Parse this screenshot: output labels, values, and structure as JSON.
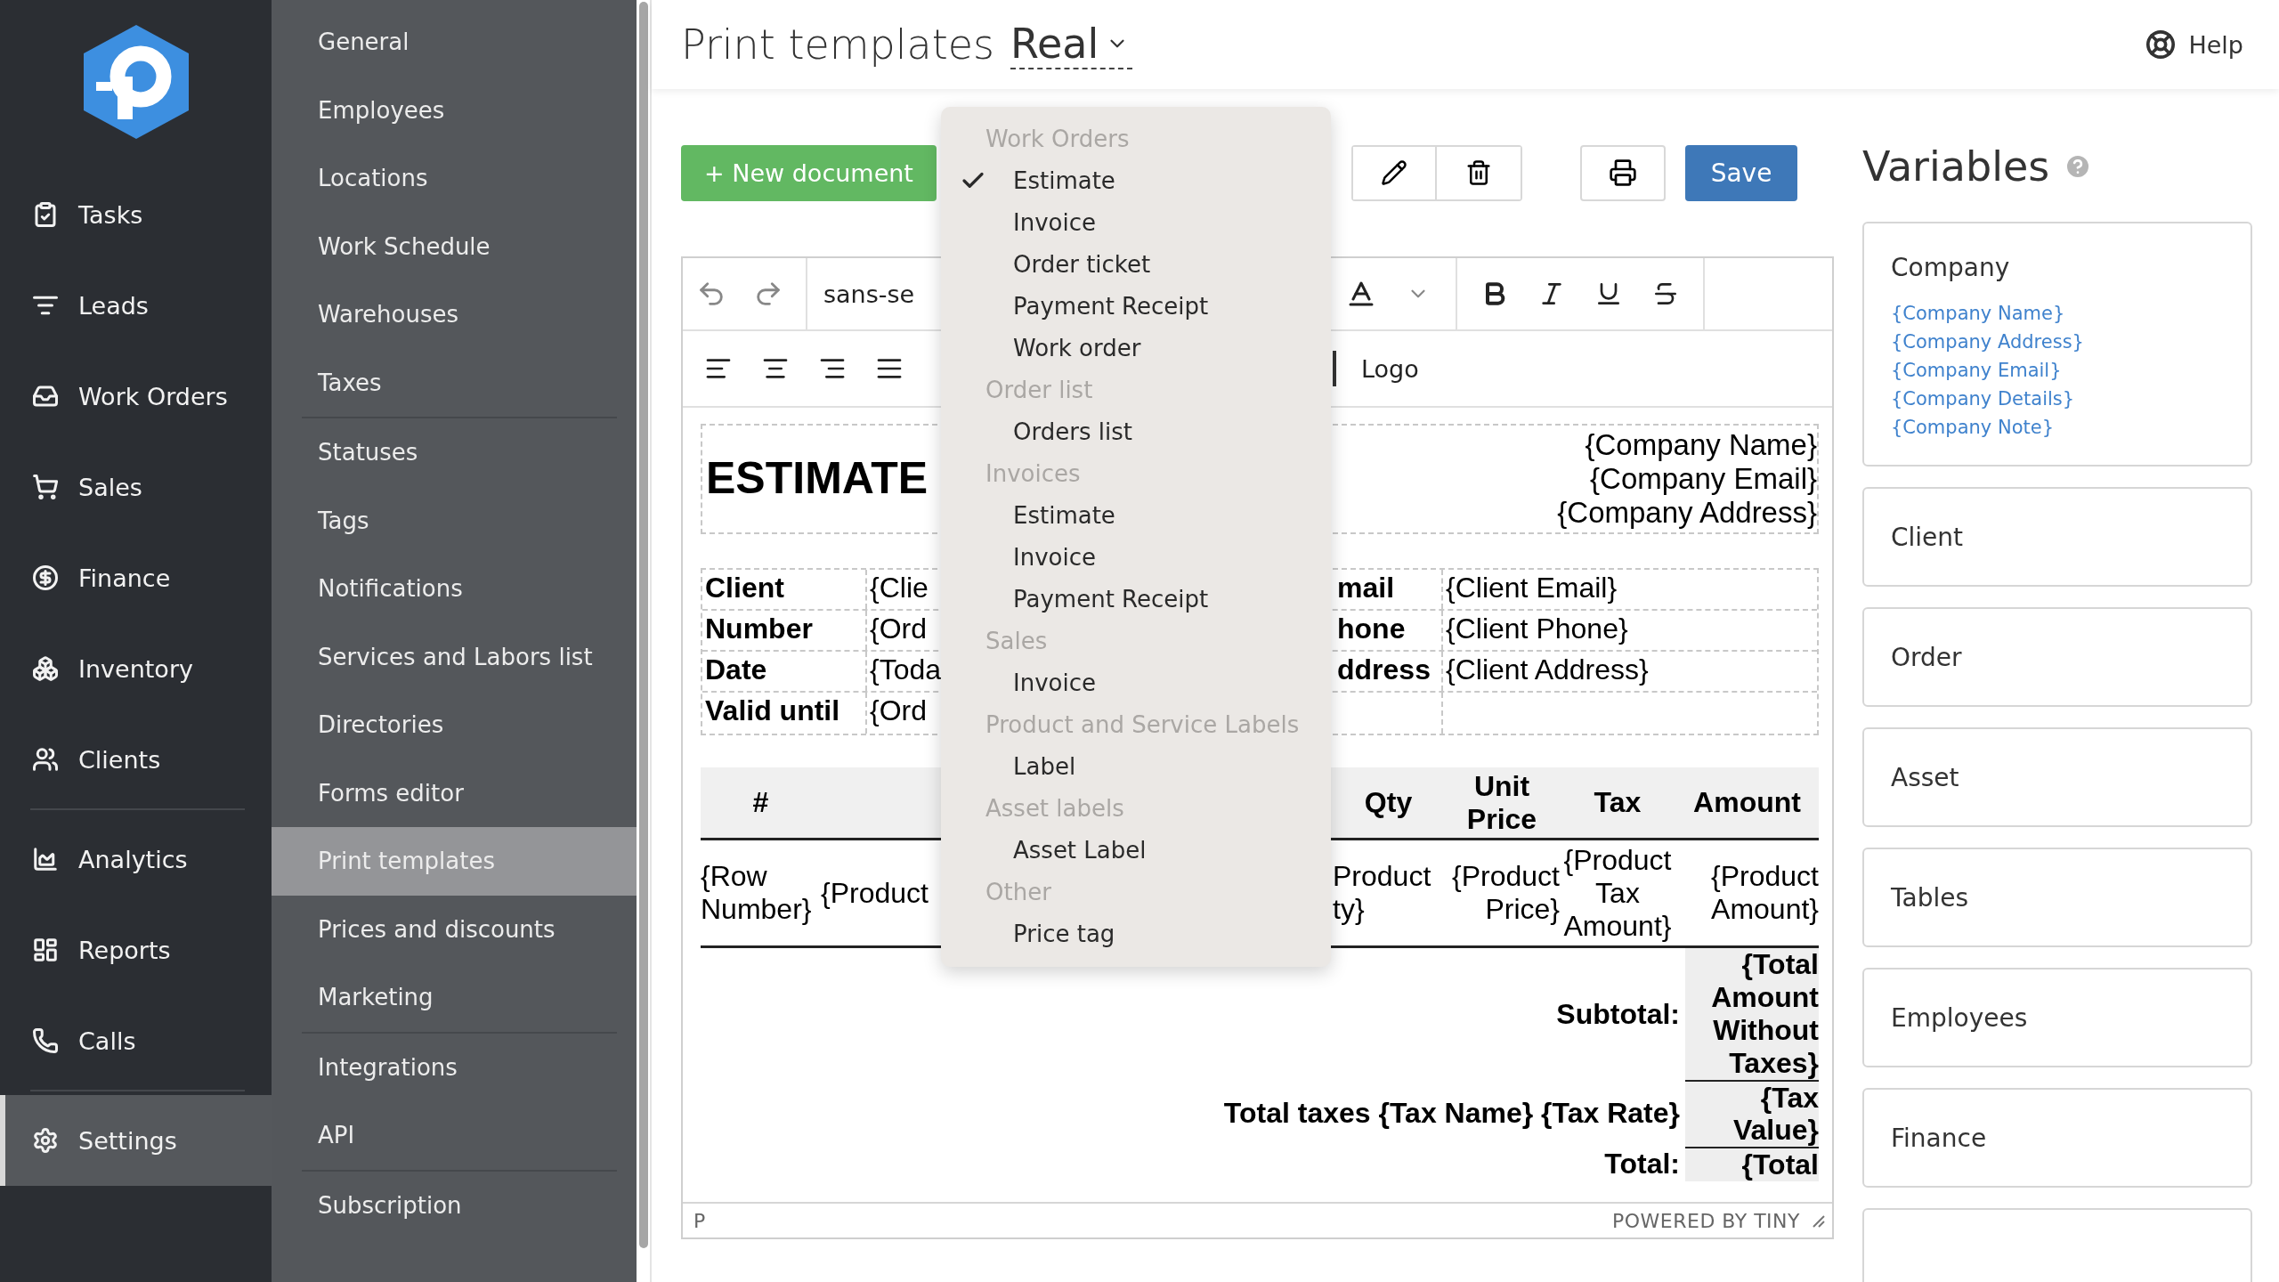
{
  "nav": {
    "groups": [
      {
        "items": [
          {
            "label": "Tasks",
            "selected": false
          },
          {
            "label": "Leads",
            "selected": false
          },
          {
            "label": "Work Orders",
            "selected": false
          },
          {
            "label": "Sales",
            "selected": false
          },
          {
            "label": "Finance",
            "selected": false
          },
          {
            "label": "Inventory",
            "selected": false
          },
          {
            "label": "Clients",
            "selected": false
          }
        ]
      },
      {
        "items": [
          {
            "label": "Analytics",
            "selected": false
          },
          {
            "label": "Reports",
            "selected": false
          },
          {
            "label": "Calls",
            "selected": false
          }
        ]
      },
      {
        "items": [
          {
            "label": "Settings",
            "selected": true
          }
        ]
      }
    ]
  },
  "settings_menu": {
    "groups": [
      {
        "items": [
          {
            "label": "General",
            "selected": false
          },
          {
            "label": "Employees",
            "selected": false
          },
          {
            "label": "Locations",
            "selected": false
          },
          {
            "label": "Work Schedule",
            "selected": false
          },
          {
            "label": "Warehouses",
            "selected": false
          },
          {
            "label": "Taxes",
            "selected": false
          }
        ]
      },
      {
        "items": [
          {
            "label": "Statuses",
            "selected": false
          },
          {
            "label": "Tags",
            "selected": false
          },
          {
            "label": "Notifications",
            "selected": false
          },
          {
            "label": "Services and Labors list",
            "selected": false
          },
          {
            "label": "Directories",
            "selected": false
          },
          {
            "label": "Forms editor",
            "selected": false
          },
          {
            "label": "Print templates",
            "selected": true
          },
          {
            "label": "Prices and discounts",
            "selected": false
          },
          {
            "label": "Marketing",
            "selected": false
          }
        ]
      },
      {
        "items": [
          {
            "label": "Integrations",
            "selected": false
          },
          {
            "label": "API",
            "selected": false
          }
        ]
      },
      {
        "items": [
          {
            "label": "Subscription",
            "selected": false
          }
        ]
      }
    ]
  },
  "header": {
    "title": "Print templates",
    "template_select": "Real",
    "help": "Help"
  },
  "toolbar": {
    "new_document": "+ New document",
    "save": "Save"
  },
  "editor": {
    "font": "sans-se",
    "block_button": "Logo",
    "status_path": "P",
    "branding": "POWERED BY TINY"
  },
  "document": {
    "heading": "ESTIMATE",
    "company_lines": [
      "{Company Name}",
      "{Company Email}",
      "{Company Address}"
    ],
    "client_rows": [
      {
        "label": "Client",
        "value": "{Clie",
        "label_2": "mail",
        "value_2": "{Client Email}"
      },
      {
        "label": "Number",
        "value": "{Ord",
        "label_2": "hone",
        "value_2": "{Client Phone}"
      },
      {
        "label": "Date",
        "value": "{Toda",
        "label_2": "ddress",
        "value_2": "{Client Address}"
      },
      {
        "label": "Valid until",
        "value": "{Ord"
      }
    ],
    "items_columns": [
      "#",
      "Qty",
      "Unit\nPrice",
      "Tax",
      "Amount"
    ],
    "items_row": [
      "{Row\nNumber}",
      "{Product",
      "Product\nty}",
      "{Product\nPrice}",
      "{Product\nTax\nAmount}",
      "{Product\nAmount}"
    ],
    "totals": [
      {
        "label": "Subtotal:",
        "value": "{Total\nAmount\nWithout\nTaxes}"
      },
      {
        "label": "Total taxes {Tax Name} {Tax Rate}",
        "value": "{Tax\nValue}"
      },
      {
        "label": "Total:",
        "value": "{Total"
      }
    ]
  },
  "template_menu": {
    "groups": [
      {
        "label": "Work Orders",
        "items": [
          {
            "label": "Estimate",
            "selected": true
          },
          {
            "label": "Invoice",
            "selected": false
          },
          {
            "label": "Order ticket",
            "selected": false
          },
          {
            "label": "Payment Receipt",
            "selected": false
          },
          {
            "label": "Work order",
            "selected": false
          }
        ]
      },
      {
        "label": "Order list",
        "items": [
          {
            "label": "Orders list",
            "selected": false
          }
        ]
      },
      {
        "label": "Invoices",
        "items": [
          {
            "label": "Estimate",
            "selected": false
          },
          {
            "label": "Invoice",
            "selected": false
          },
          {
            "label": "Payment Receipt",
            "selected": false
          }
        ]
      },
      {
        "label": "Sales",
        "items": [
          {
            "label": "Invoice",
            "selected": false
          }
        ]
      },
      {
        "label": "Product and Service Labels",
        "items": [
          {
            "label": "Label",
            "selected": false
          }
        ]
      },
      {
        "label": "Asset labels",
        "items": [
          {
            "label": "Asset Label",
            "selected": false
          }
        ]
      },
      {
        "label": "Other",
        "items": [
          {
            "label": "Price tag",
            "selected": false
          }
        ]
      }
    ]
  },
  "variables": {
    "title": "Variables",
    "sections": [
      {
        "title": "Company",
        "items": [
          "{Company Name}",
          "{Company Address}",
          "{Company Email}",
          "{Company Details}",
          "{Company Note}"
        ]
      },
      {
        "title": "Client"
      },
      {
        "title": "Order"
      },
      {
        "title": "Asset"
      },
      {
        "title": "Tables"
      },
      {
        "title": "Employees"
      },
      {
        "title": "Finance"
      }
    ]
  }
}
